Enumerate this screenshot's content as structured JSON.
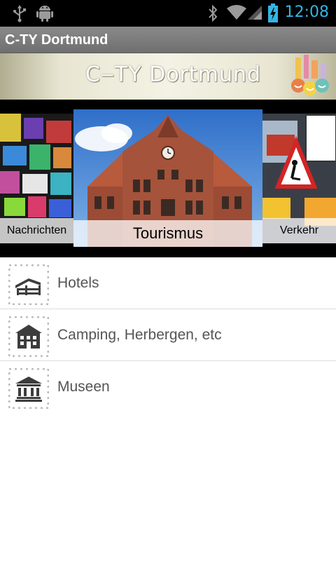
{
  "status_bar": {
    "time": "12:08",
    "icons": [
      "usb-icon",
      "android-debug-icon",
      "bluetooth-icon",
      "wifi-icon",
      "signal-icon",
      "battery-charging-icon"
    ],
    "accent_color": "#33b5e5"
  },
  "app_bar": {
    "title": "C-TY Dortmund"
  },
  "banner": {
    "logo_text": "C‒TY Dortmund"
  },
  "carousel": {
    "items": [
      {
        "label": "Nachrichten"
      },
      {
        "label": "Tourismus"
      },
      {
        "label": "Verkehr"
      }
    ],
    "selected": "Tourismus"
  },
  "list": {
    "items": [
      {
        "label": "Hotels",
        "icon": "hotel-icon"
      },
      {
        "label": "Camping, Herbergen, etc",
        "icon": "hostel-icon"
      },
      {
        "label": "Museen",
        "icon": "museum-icon"
      }
    ]
  }
}
